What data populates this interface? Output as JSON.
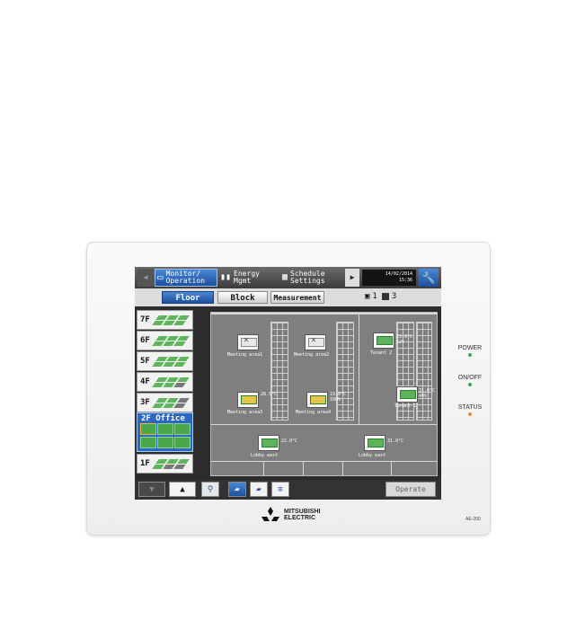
{
  "nav": {
    "monitor_label": "Monitor/\nOperation",
    "energy_label": "Energy\nMgmt",
    "schedule_label": "Schedule\nSettings",
    "date": "14/02/2014",
    "time": "15:36"
  },
  "tabs": {
    "floor": "Floor",
    "block": "Block",
    "measurement": "Measurement"
  },
  "counts": {
    "first": "1",
    "second": "3"
  },
  "floors": {
    "f7": "7F",
    "f6": "6F",
    "f5": "5F",
    "f4": "4F",
    "f3": "3F",
    "f2": "2F Office",
    "f1": "1F"
  },
  "map": {
    "meeting1": "Meeting area1",
    "meeting2": "Meeting area2",
    "tenant2": "Tenant 2",
    "tenant2_temp": "23.0°C",
    "tenant2_hum": "52%",
    "meeting3": "Meeting area3",
    "meeting3_temp": "28.5°C",
    "meeting4": "Meeting area4",
    "meeting4_temp": "19.0°C",
    "meeting4_hum": "108%",
    "tenant1": "Tenant 1",
    "tenant1_temp": "31.0°C",
    "tenant1_hum": "40%",
    "lobby_west": "Lobby west",
    "lobby_west_temp": "22.0°C",
    "lobby_east": "Lobby east",
    "lobby_east_temp": "31.0°C"
  },
  "toolbar": {
    "operate": "Operate"
  },
  "indicators": {
    "power": "POWER",
    "onoff": "ON/OFF",
    "status": "STATUS",
    "power_color": "#3fa34d",
    "onoff_color": "#3fa34d",
    "status_color": "#f08a24"
  },
  "brand": {
    "line1": "MITSUBISHI",
    "line2": "ELECTRIC",
    "model": "AE-200"
  },
  "icons": [
    "back-arrow-icon",
    "monitor-icon",
    "bar-chart-icon",
    "calendar-icon",
    "next-arrow-icon",
    "wrench-icon",
    "zoom-icon",
    "layer-view-icon"
  ]
}
